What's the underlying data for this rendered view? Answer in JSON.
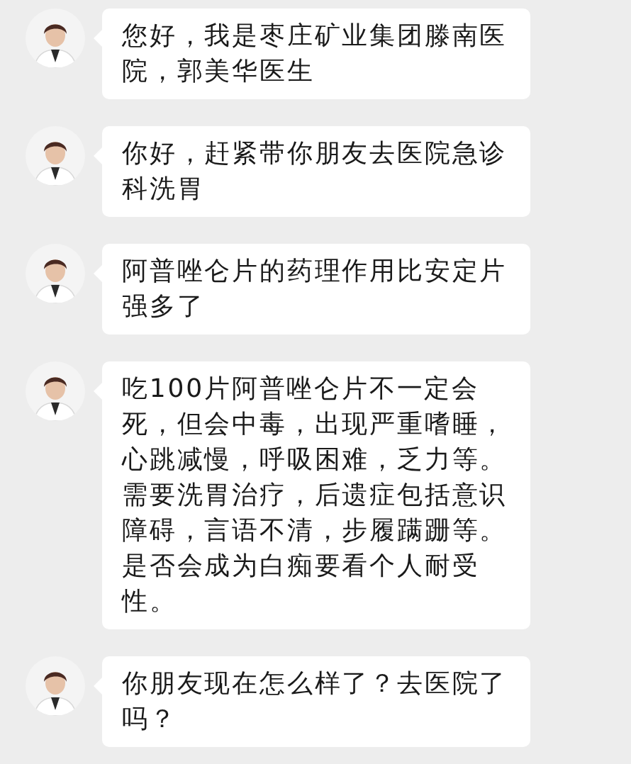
{
  "messages": [
    {
      "text": "您好，我是枣庄矿业集团滕南医院，郭美华医生"
    },
    {
      "text": "你好，赶紧带你朋友去医院急诊科洗胃"
    },
    {
      "text": "阿普唑仑片的药理作用比安定片强多了"
    },
    {
      "text": "吃100片阿普唑仑片不一定会死，但会中毒，出现严重嗜睡，心跳减慢，呼吸困难，乏力等。需要洗胃治疗，后遗症包括意识障碍，言语不清，步履蹒跚等。是否会成为白痴要看个人耐受性。"
    },
    {
      "text": "你朋友现在怎么样了？去医院了吗？"
    }
  ]
}
